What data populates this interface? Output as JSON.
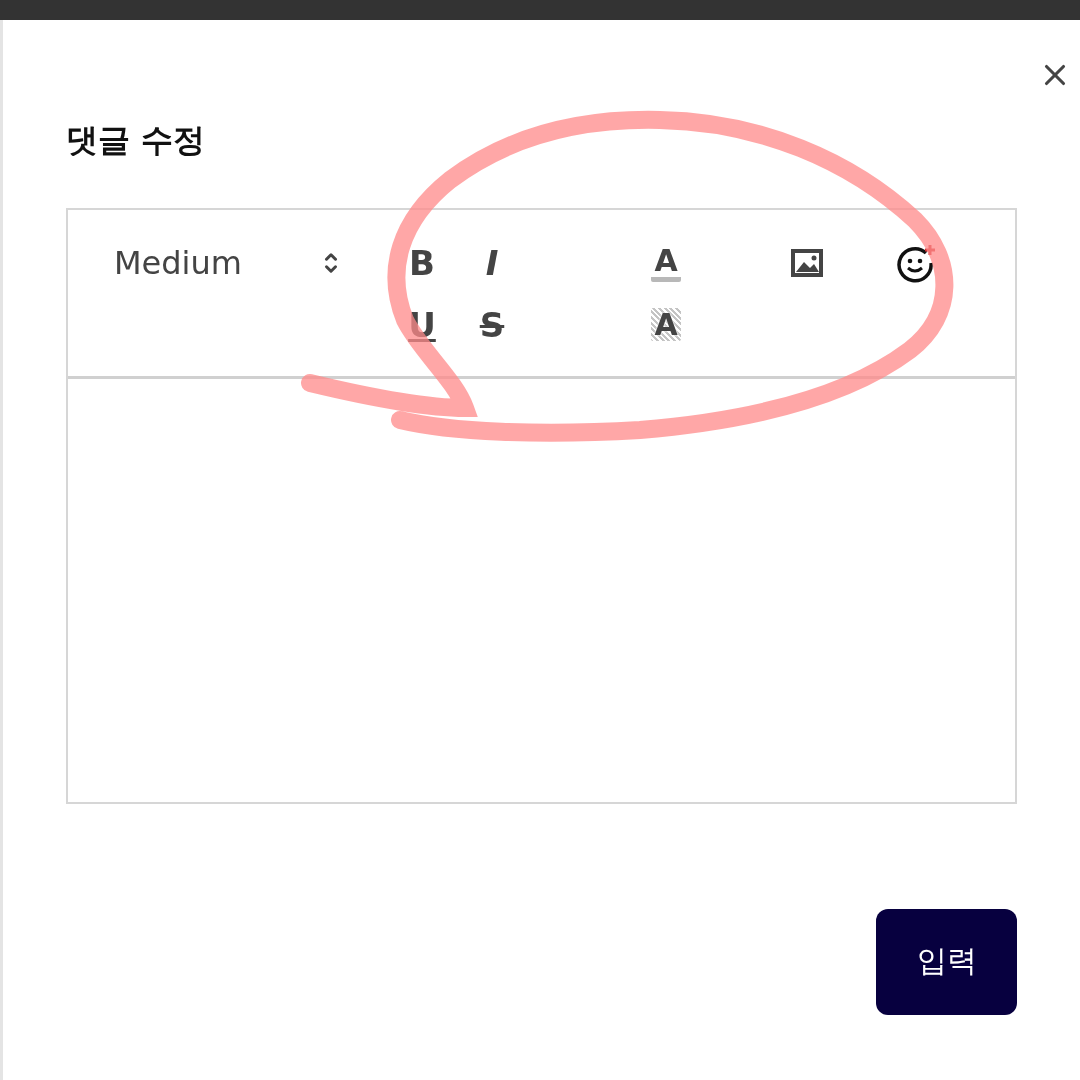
{
  "dialog": {
    "title": "댓글 수정"
  },
  "editor": {
    "font_size": {
      "value": "Medium"
    },
    "format": [
      {
        "label": "B",
        "kind": "bold"
      },
      {
        "label": "I",
        "kind": "italic"
      },
      {
        "label": "U",
        "kind": "underline"
      },
      {
        "label": "S",
        "kind": "strike"
      }
    ],
    "colors": [
      {
        "kind": "text_color",
        "label": "A",
        "color": "#b8b8b8"
      },
      {
        "kind": "highlight",
        "label": "A"
      }
    ],
    "insert": [
      {
        "kind": "image"
      },
      {
        "kind": "emoji"
      }
    ]
  },
  "submit": {
    "label": "입력"
  }
}
